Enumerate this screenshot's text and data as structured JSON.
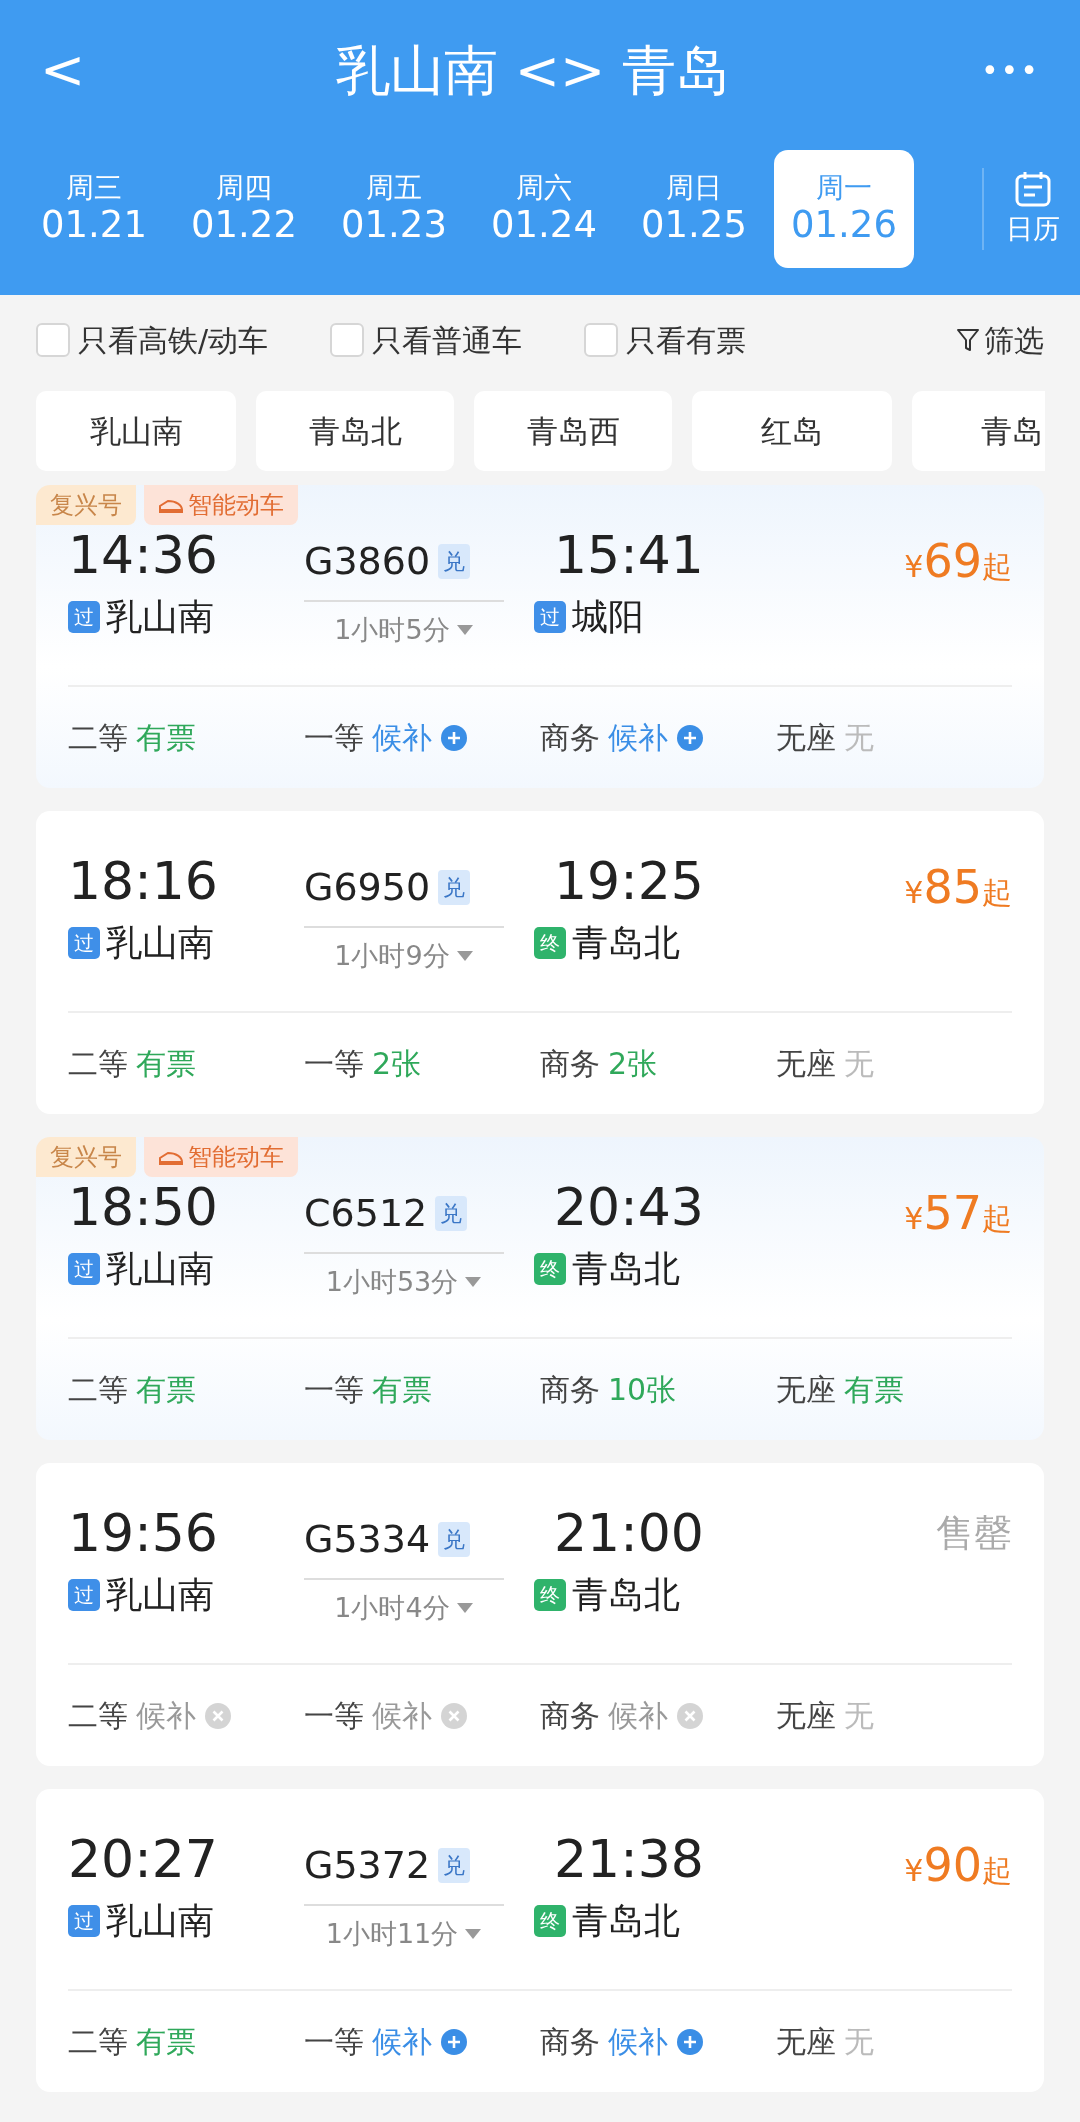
{
  "header": {
    "back": "<",
    "title": "乳山南 <> 青岛",
    "more": "•••"
  },
  "dates": [
    {
      "weekday": "周三",
      "date": "01.21",
      "selected": false
    },
    {
      "weekday": "周四",
      "date": "01.22",
      "selected": false
    },
    {
      "weekday": "周五",
      "date": "01.23",
      "selected": false
    },
    {
      "weekday": "周六",
      "date": "01.24",
      "selected": false
    },
    {
      "weekday": "周日",
      "date": "01.25",
      "selected": false
    },
    {
      "weekday": "周一",
      "date": "01.26",
      "selected": true
    }
  ],
  "calendar": {
    "label": "日历"
  },
  "filters": [
    {
      "label": "只看高铁/动车",
      "checked": false
    },
    {
      "label": "只看普通车",
      "checked": false
    },
    {
      "label": "只看有票",
      "checked": false
    }
  ],
  "filter_button": "筛选",
  "stations": [
    {
      "label": "乳山南"
    },
    {
      "label": "青岛北"
    },
    {
      "label": "青岛西"
    },
    {
      "label": "红岛"
    },
    {
      "label": "青岛"
    }
  ],
  "trains": [
    {
      "tags": [
        {
          "kind": "plain",
          "text": "复兴号"
        },
        {
          "kind": "smart",
          "text": "智能动车"
        }
      ],
      "depart": "14:36",
      "number": "G3860",
      "badge": "兑",
      "arrive": "15:41",
      "duration": "1小时5分",
      "from": {
        "kind": "pass",
        "mark": "过",
        "name": "乳山南"
      },
      "to": {
        "kind": "pass",
        "mark": "过",
        "name": "城阳"
      },
      "price": {
        "kind": "price",
        "currency": "¥",
        "amount": "69",
        "suffix": "起"
      },
      "seats": [
        {
          "label": "二等",
          "status": "有票",
          "kind": "available"
        },
        {
          "label": "一等",
          "status": "候补",
          "kind": "waitlist"
        },
        {
          "label": "商务",
          "status": "候补",
          "kind": "waitlist"
        },
        {
          "label": "无座",
          "status": "无",
          "kind": "none"
        }
      ]
    },
    {
      "depart": "18:16",
      "number": "G6950",
      "badge": "兑",
      "arrive": "19:25",
      "duration": "1小时9分",
      "from": {
        "kind": "pass",
        "mark": "过",
        "name": "乳山南"
      },
      "to": {
        "kind": "end",
        "mark": "终",
        "name": "青岛北"
      },
      "price": {
        "kind": "price",
        "currency": "¥",
        "amount": "85",
        "suffix": "起"
      },
      "seats": [
        {
          "label": "二等",
          "status": "有票",
          "kind": "available"
        },
        {
          "label": "一等",
          "status": "2张",
          "kind": "available"
        },
        {
          "label": "商务",
          "status": "2张",
          "kind": "available"
        },
        {
          "label": "无座",
          "status": "无",
          "kind": "none"
        }
      ]
    },
    {
      "tags": [
        {
          "kind": "plain",
          "text": "复兴号"
        },
        {
          "kind": "smart",
          "text": "智能动车"
        }
      ],
      "depart": "18:50",
      "number": "C6512",
      "badge": "兑",
      "arrive": "20:43",
      "duration": "1小时53分",
      "from": {
        "kind": "pass",
        "mark": "过",
        "name": "乳山南"
      },
      "to": {
        "kind": "end",
        "mark": "终",
        "name": "青岛北"
      },
      "price": {
        "kind": "price",
        "currency": "¥",
        "amount": "57",
        "suffix": "起"
      },
      "seats": [
        {
          "label": "二等",
          "status": "有票",
          "kind": "available"
        },
        {
          "label": "一等",
          "status": "有票",
          "kind": "available"
        },
        {
          "label": "商务",
          "status": "10张",
          "kind": "available"
        },
        {
          "label": "无座",
          "status": "有票",
          "kind": "available"
        }
      ]
    },
    {
      "depart": "19:56",
      "number": "G5334",
      "badge": "兑",
      "arrive": "21:00",
      "duration": "1小时4分",
      "from": {
        "kind": "pass",
        "mark": "过",
        "name": "乳山南"
      },
      "to": {
        "kind": "end",
        "mark": "终",
        "name": "青岛北"
      },
      "price": {
        "kind": "soldout",
        "text": "售罄"
      },
      "seats": [
        {
          "label": "二等",
          "status": "候补",
          "kind": "closed"
        },
        {
          "label": "一等",
          "status": "候补",
          "kind": "closed"
        },
        {
          "label": "商务",
          "status": "候补",
          "kind": "closed"
        },
        {
          "label": "无座",
          "status": "无",
          "kind": "none"
        }
      ]
    },
    {
      "depart": "20:27",
      "number": "G5372",
      "badge": "兑",
      "arrive": "21:38",
      "duration": "1小时11分",
      "from": {
        "kind": "pass",
        "mark": "过",
        "name": "乳山南"
      },
      "to": {
        "kind": "end",
        "mark": "终",
        "name": "青岛北"
      },
      "price": {
        "kind": "price",
        "currency": "¥",
        "amount": "90",
        "suffix": "起"
      },
      "seats": [
        {
          "label": "二等",
          "status": "有票",
          "kind": "available"
        },
        {
          "label": "一等",
          "status": "候补",
          "kind": "waitlist"
        },
        {
          "label": "商务",
          "status": "候补",
          "kind": "waitlist"
        },
        {
          "label": "无座",
          "status": "无",
          "kind": "none"
        }
      ]
    }
  ]
}
